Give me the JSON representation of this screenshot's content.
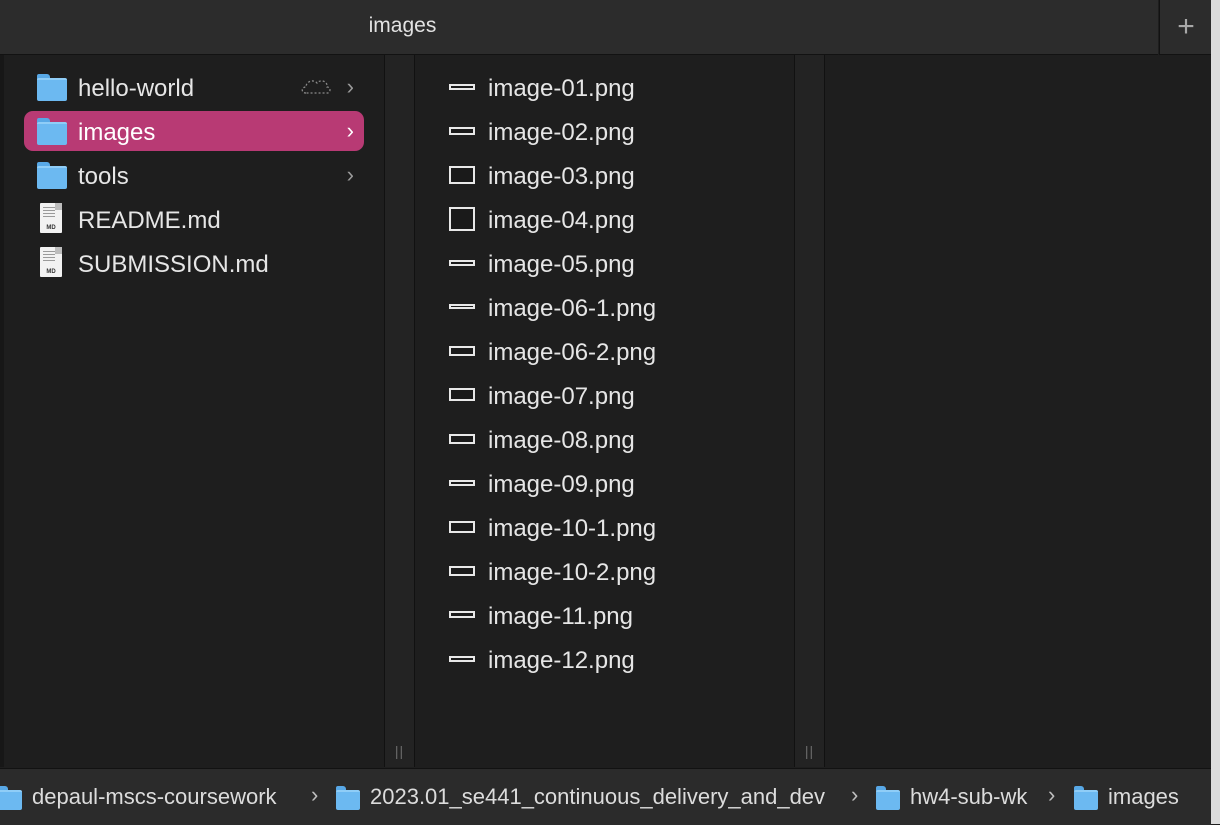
{
  "window": {
    "title": "images",
    "new_tab_icon": "plus-icon",
    "new_tab_label": "+"
  },
  "column1": {
    "items": [
      {
        "name": "hello-world",
        "type": "folder",
        "icloud": true,
        "has_children": true
      },
      {
        "name": "images",
        "type": "folder",
        "selected": true,
        "has_children": true
      },
      {
        "name": "tools",
        "type": "folder",
        "has_children": true
      },
      {
        "name": "README.md",
        "type": "markdown"
      },
      {
        "name": "SUBMISSION.md",
        "type": "markdown"
      }
    ],
    "chevron": "›",
    "doc_badge": "MD"
  },
  "column2": {
    "items": [
      {
        "name": "image-01.png"
      },
      {
        "name": "image-02.png"
      },
      {
        "name": "image-03.png"
      },
      {
        "name": "image-04.png"
      },
      {
        "name": "image-05.png"
      },
      {
        "name": "image-06-1.png"
      },
      {
        "name": "image-06-2.png"
      },
      {
        "name": "image-07.png"
      },
      {
        "name": "image-08.png"
      },
      {
        "name": "image-09.png"
      },
      {
        "name": "image-10-1.png"
      },
      {
        "name": "image-10-2.png"
      },
      {
        "name": "image-11.png"
      },
      {
        "name": "image-12.png"
      }
    ]
  },
  "column_resize_grip": "||",
  "pathbar": {
    "segments": [
      {
        "label": "depaul-mscs-coursework"
      },
      {
        "label": "2023.01_se441_continuous_delivery_and_dev"
      },
      {
        "label": "hw4-sub-wk"
      },
      {
        "label": "images"
      }
    ],
    "separator": "›"
  },
  "colors": {
    "selection": "#b83a74",
    "folder": "#6cb9f1",
    "background": "#1e1e1e"
  }
}
